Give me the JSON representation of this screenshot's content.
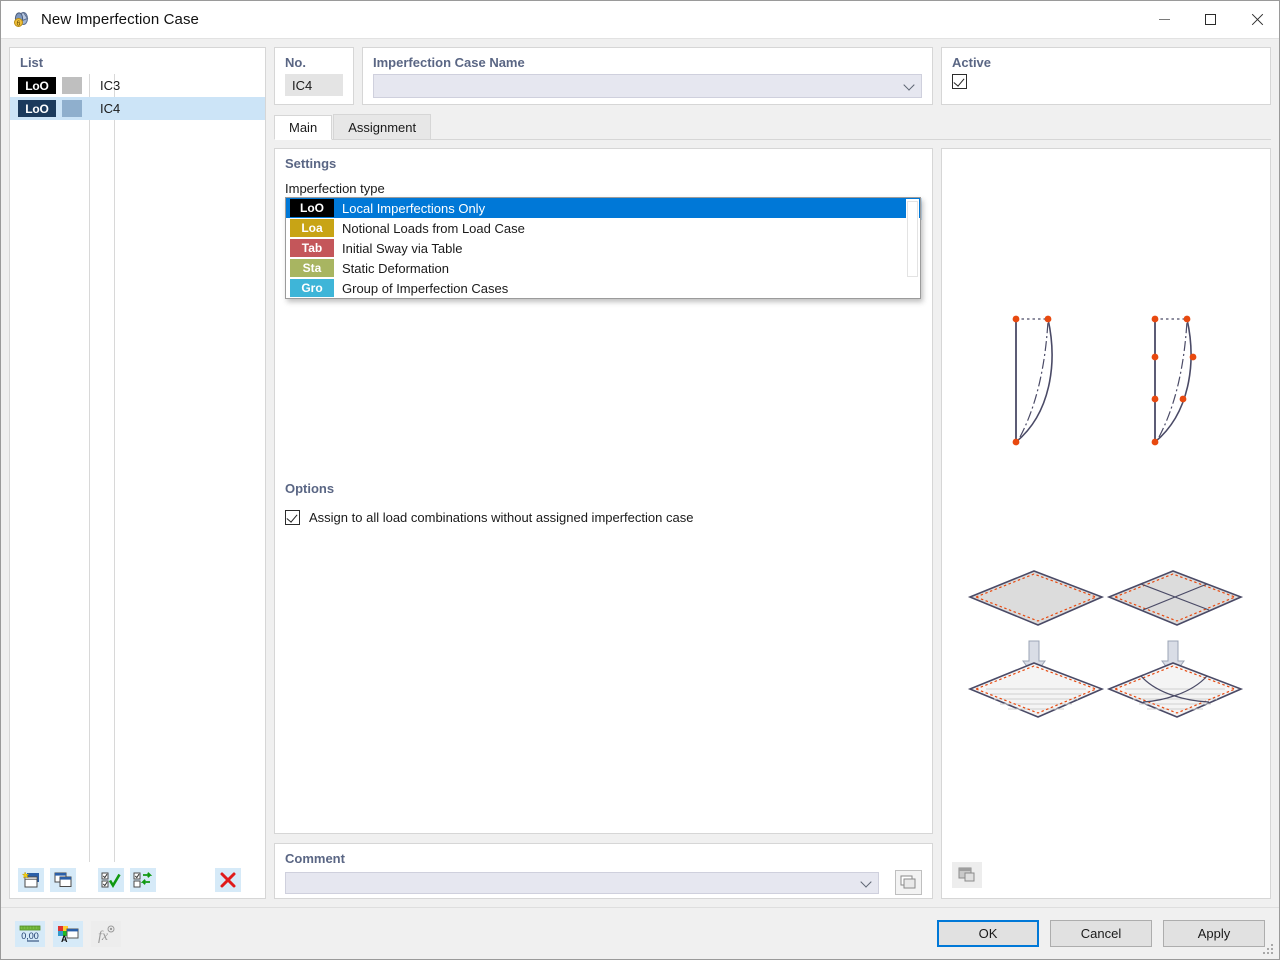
{
  "window": {
    "title": "New Imperfection Case",
    "icon": "imperfection-case-icon",
    "controls": {
      "minimize": "minimize-icon",
      "maximize": "maximize-icon",
      "close": "close-icon"
    }
  },
  "list_panel": {
    "title": "List",
    "rows": [
      {
        "badge": "LoO",
        "badge_color": "#000000",
        "swatch_color": "#bfbfbf",
        "label": "IC3",
        "selected": false
      },
      {
        "badge": "LoO",
        "badge_color": "#1b3a5c",
        "swatch_color": "#8fafcd",
        "label": "IC4",
        "selected": true
      }
    ],
    "toolbar": [
      {
        "name": "new-imperfection-case-button",
        "icon": "new-window-icon"
      },
      {
        "name": "copy-imperfection-case-button",
        "icon": "copy-window-icon"
      },
      {
        "name": "select-all-button",
        "icon": "checklist-check-icon"
      },
      {
        "name": "invert-selection-button",
        "icon": "checklist-swap-icon"
      },
      {
        "name": "delete-button",
        "icon": "red-x-icon"
      }
    ]
  },
  "header": {
    "no_label": "No.",
    "no_value": "IC4",
    "name_label": "Imperfection Case Name",
    "name_value": "",
    "active_label": "Active",
    "active_checked": true
  },
  "tabs": [
    {
      "label": "Main",
      "active": true
    },
    {
      "label": "Assignment",
      "active": false
    }
  ],
  "settings": {
    "title": "Settings",
    "type_label": "Imperfection type",
    "selected_type": {
      "badge": "LoO",
      "badge_color": "#000000",
      "label": "Local Imperfections Only"
    },
    "dropdown_open": true,
    "dropdown_items": [
      {
        "badge": "LoO",
        "badge_color": "#000000",
        "label": "Local Imperfections Only",
        "selected": true
      },
      {
        "badge": "Loa",
        "badge_color": "#c8a415",
        "label": "Notional Loads from Load Case",
        "selected": false
      },
      {
        "badge": "Tab",
        "badge_color": "#c4565a",
        "label": "Initial Sway via Table",
        "selected": false
      },
      {
        "badge": "Sta",
        "badge_color": "#a8b561",
        "label": "Static Deformation",
        "selected": false
      },
      {
        "badge": "Gro",
        "badge_color": "#3eb5d8",
        "label": "Group of Imperfection Cases",
        "selected": false
      }
    ]
  },
  "options": {
    "title": "Options",
    "assign_all_label": "Assign to all load combinations without assigned imperfection case",
    "assign_all_checked": true
  },
  "comment": {
    "title": "Comment",
    "value": "",
    "button_icon": "comment-library-icon"
  },
  "preview": {
    "button_icon": "preview-image-icon",
    "diagrams": [
      "column-local-imperfection-single",
      "column-local-imperfection-multi",
      "surface-flat-edge-nodes",
      "surface-flat-grid-nodes",
      "surface-deformed-edge-nodes",
      "surface-deformed-grid-nodes"
    ]
  },
  "footer": {
    "tools": [
      {
        "name": "units-and-decimal-places-button",
        "icon": "numeric-0-00-icon",
        "disabled": false
      },
      {
        "name": "display-properties-button",
        "icon": "color-palette-icon",
        "disabled": false
      },
      {
        "name": "formula-button",
        "icon": "fx-icon",
        "disabled": true
      }
    ],
    "buttons": [
      {
        "name": "ok-button",
        "label": "OK",
        "primary": true
      },
      {
        "name": "cancel-button",
        "label": "Cancel",
        "primary": false
      },
      {
        "name": "apply-button",
        "label": "Apply",
        "primary": false
      }
    ]
  },
  "colors": {
    "accent": "#0078d7",
    "selection": "#cce4f7",
    "group_title": "#5a6684",
    "field_bg": "#e6e7f0"
  }
}
